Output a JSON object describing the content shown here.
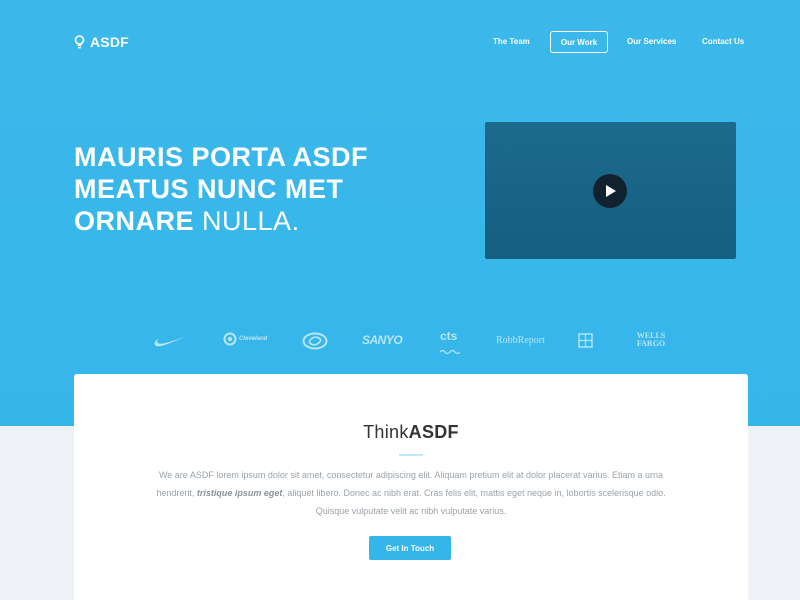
{
  "header": {
    "logo_text": "ASDF",
    "nav": [
      {
        "label": "The Team"
      },
      {
        "label": "Our Work",
        "active": true
      },
      {
        "label": "Our Services"
      },
      {
        "label": "Contact Us"
      }
    ]
  },
  "hero": {
    "headline_line1": "MAURIS PORTA ASDF",
    "headline_line2": "MEATUS NUNC MET",
    "headline_line3_bold": "ORNARE",
    "headline_line3_thin": "NULLA."
  },
  "brands": [
    {
      "name": "nike-logo"
    },
    {
      "name": "cleveland-logo",
      "text": "Cleveland"
    },
    {
      "name": "scion-logo"
    },
    {
      "name": "sanyo-logo",
      "text": "SANYO"
    },
    {
      "name": "cts-logo",
      "text": "cts"
    },
    {
      "name": "robb-report-logo",
      "text": "RobbReport"
    },
    {
      "name": "grid-logo"
    },
    {
      "name": "wells-fargo-logo",
      "text": "WELLS FARGO"
    }
  ],
  "intro": {
    "title_thin": "Think",
    "title_bold": "ASDF",
    "paragraph_part1": "We are ASDF lorem ipsum dolor sit amet, consectetur adipiscing elit. Aliquam pretium elit at dolor placerat varius. Etiam a urna hendrerit, ",
    "paragraph_emphasis": "tristique ipsum eget",
    "paragraph_part2": ", aliquet libero. Donec ac nibh erat. Cras felis elit, mattis eget neque in, lobortis scelerisque odio. Quisque vulputate velit ac nibh vulputate varius.",
    "cta_label": "Get In Touch"
  },
  "colors": {
    "brand_blue": "#35b6ea",
    "video_bg": "#1a6586",
    "play_button": "#10222e",
    "page_bg": "#eef2f6"
  }
}
